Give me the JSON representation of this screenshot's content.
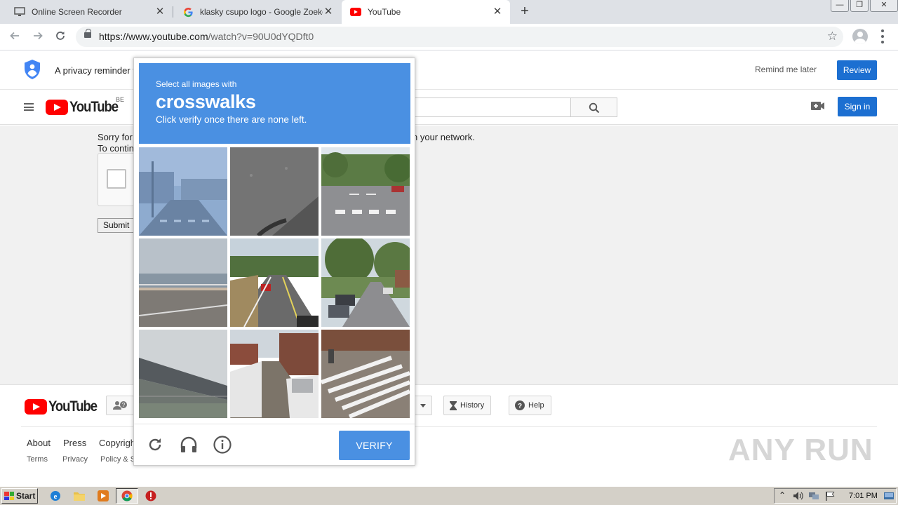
{
  "browser": {
    "tabs": [
      {
        "title": "Online Screen Recorder",
        "icon": "monitor-icon"
      },
      {
        "title": "klasky csupo logo - Google Zoeken",
        "icon": "google-g-icon"
      },
      {
        "title": "YouTube",
        "icon": "youtube-icon",
        "active": true
      }
    ],
    "new_tab": "+",
    "close_glyph": "✕",
    "window_controls": [
      "—",
      "❐",
      "✕"
    ],
    "url_host": "https://www.youtube.com",
    "url_path": "/watch?v=90U0dYQDft0"
  },
  "privacy": {
    "text": "A privacy reminder f",
    "remind_label": "Remind me later",
    "review_label": "Review"
  },
  "header": {
    "logo_text": "YouTube",
    "country_code": "BE",
    "signin_label": "Sign in"
  },
  "page": {
    "sorry_line1": "Sorry for",
    "sorry_line1_end": "n your network.",
    "sorry_line2": "To contin",
    "submit_label": "Submit"
  },
  "captcha": {
    "instruction": "Select all images with",
    "target": "crosswalks",
    "note": "Click verify once there are none left.",
    "verify_label": "VERIFY",
    "tiles": [
      {
        "name": "street-with-crosswalk-faded"
      },
      {
        "name": "asphalt-closeup"
      },
      {
        "name": "residential-street-crosswalk"
      },
      {
        "name": "waterfront-road"
      },
      {
        "name": "highway-with-car"
      },
      {
        "name": "tree-lined-street-cars"
      },
      {
        "name": "highway-overpass"
      },
      {
        "name": "snowy-alley"
      },
      {
        "name": "crosswalk-stripes-closeup"
      }
    ]
  },
  "footer": {
    "logo_text": "YouTube",
    "history_label": "History",
    "help_label": "Help",
    "links_primary": [
      "About",
      "Press",
      "Copyrigh"
    ],
    "links_secondary": [
      "Terms",
      "Privacy",
      "Policy & S"
    ],
    "watermark": "ANY RUN"
  },
  "taskbar": {
    "start_label": "Start",
    "clock": "7:01 PM"
  },
  "colors": {
    "captcha_blue": "#4a90e2",
    "youtube_red": "#ff0000",
    "button_blue": "#1c6fd1"
  }
}
